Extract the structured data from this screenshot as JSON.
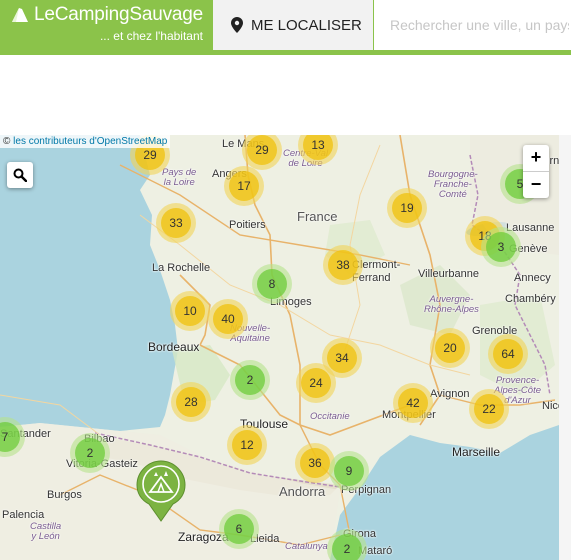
{
  "header": {
    "brand_title": "LeCampingSauvage",
    "brand_subtitle": "... et chez l'habitant",
    "locate_label": "ME LOCALISER",
    "search_placeholder": "Rechercher une ville, un pays...",
    "brand_color": "#8bc34a"
  },
  "map": {
    "attribution_prefix": "© ",
    "attribution_link": "les contributeurs d'OpenStreetMap",
    "zoom_in": "+",
    "zoom_out": "−",
    "search_icon": "magnifier-icon",
    "countries": {
      "france": "France",
      "andorra": "Andorra"
    },
    "cities": {
      "le_mans": "Le Mans",
      "angers": "Angers",
      "poitiers": "Poitiers",
      "la_rochelle": "La Rochelle",
      "limoges": "Limoges",
      "clermont": "Clermont-\nFerrand",
      "villeurbanne": "Villeurbanne",
      "chambery": "Chambéry",
      "annecy": "Annecy",
      "lausanne": "Lausanne",
      "geneve": "Genève",
      "grenoble": "Grenoble",
      "bordeaux": "Bordeaux",
      "toulouse": "Toulouse",
      "montpellier": "Montpellier",
      "avignon": "Avignon",
      "marseille": "Marseille",
      "perpignan": "Perpignan",
      "bilbao": "Bilbao",
      "vitoria": "Vitoria-Gasteiz",
      "santander": "Santander",
      "burgos": "Burgos",
      "palencia": "Palencia",
      "zaragoza": "Zaragoza",
      "lleida": "Lleida",
      "girona": "Girona",
      "mataro": "Mataró",
      "castilla": "Castilla\ny León",
      "catalunya": "Catalunya",
      "nice": "Nice",
      "bern": "Bern"
    },
    "regions": {
      "centre": "Centre-Val\nde Loire",
      "pays_loire": "Pays de\nla Loire",
      "bourgogne": "Bourgogne-\nFranche-\nComté",
      "nouvelle_aquitaine": "Nouvelle-\nAquitaine",
      "auvergne": "Auvergne-\nRhône-Alpes",
      "occitanie": "Occitanie",
      "paca": "Provence-\nAlpes-Côte\nd'Azur"
    },
    "clusters": [
      {
        "count": "29",
        "color": "yellow",
        "name": "cluster-29-west"
      },
      {
        "count": "29",
        "color": "yellow",
        "name": "cluster-29-lemans"
      },
      {
        "count": "13",
        "color": "yellow",
        "name": "cluster-13"
      },
      {
        "count": "17",
        "color": "yellow",
        "name": "cluster-17"
      },
      {
        "count": "33",
        "color": "yellow",
        "name": "cluster-33"
      },
      {
        "count": "19",
        "color": "yellow",
        "name": "cluster-19"
      },
      {
        "count": "5",
        "color": "green",
        "name": "cluster-5"
      },
      {
        "count": "18",
        "color": "yellow",
        "name": "cluster-18"
      },
      {
        "count": "3",
        "color": "green",
        "name": "cluster-3"
      },
      {
        "count": "38",
        "color": "yellow",
        "name": "cluster-38"
      },
      {
        "count": "8",
        "color": "green",
        "name": "cluster-8"
      },
      {
        "count": "10",
        "color": "yellow",
        "name": "cluster-10"
      },
      {
        "count": "40",
        "color": "yellow",
        "name": "cluster-40"
      },
      {
        "count": "20",
        "color": "yellow",
        "name": "cluster-20"
      },
      {
        "count": "64",
        "color": "yellow",
        "name": "cluster-64"
      },
      {
        "count": "34",
        "color": "yellow",
        "name": "cluster-34"
      },
      {
        "count": "2",
        "color": "green",
        "name": "cluster-2-aquitaine"
      },
      {
        "count": "24",
        "color": "yellow",
        "name": "cluster-24"
      },
      {
        "count": "28",
        "color": "yellow",
        "name": "cluster-28"
      },
      {
        "count": "42",
        "color": "yellow",
        "name": "cluster-42"
      },
      {
        "count": "22",
        "color": "yellow",
        "name": "cluster-22"
      },
      {
        "count": "7",
        "color": "green",
        "name": "cluster-7"
      },
      {
        "count": "2",
        "color": "green",
        "name": "cluster-2-bilbao"
      },
      {
        "count": "12",
        "color": "yellow",
        "name": "cluster-12"
      },
      {
        "count": "36",
        "color": "yellow",
        "name": "cluster-36"
      },
      {
        "count": "9",
        "color": "green",
        "name": "cluster-9"
      },
      {
        "count": "6",
        "color": "green",
        "name": "cluster-6"
      },
      {
        "count": "2",
        "color": "green",
        "name": "cluster-2-catalonia"
      }
    ],
    "marker_icon": "camping-pin-icon"
  }
}
